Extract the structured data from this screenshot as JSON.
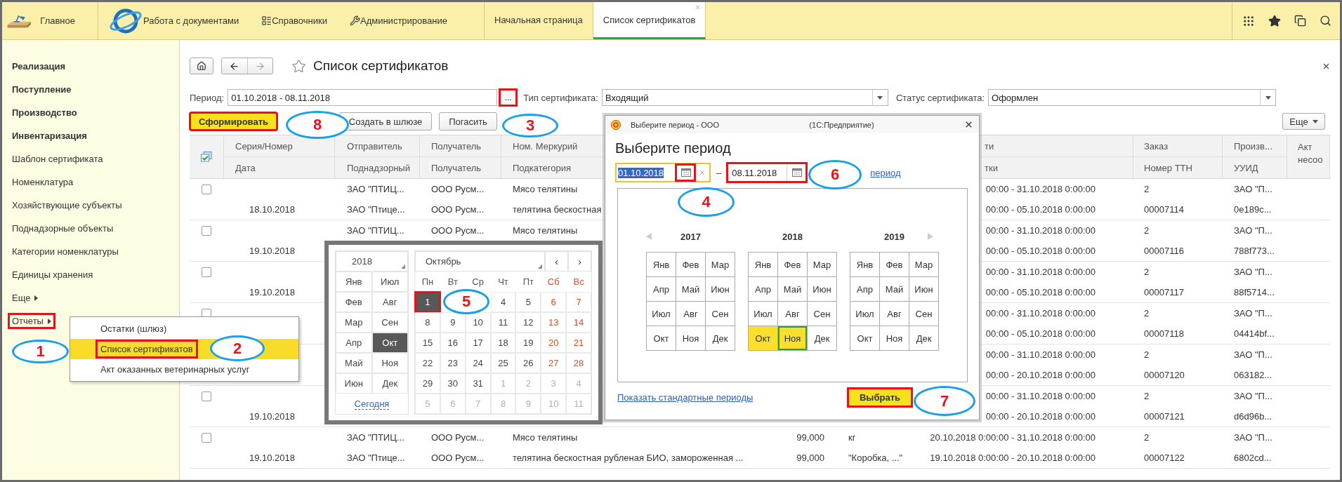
{
  "top_bar": {
    "sections": [
      {
        "label": "Главное",
        "kind": "home"
      },
      {
        "label": "Работа с документами",
        "kind": "globe"
      },
      {
        "label": "Справочники",
        "kind": "list"
      },
      {
        "label": "Администрирование",
        "kind": "wrench"
      }
    ],
    "tabs": [
      {
        "label": "Начальная страница",
        "selected": false
      },
      {
        "label": "Список сертификатов",
        "selected": true
      }
    ]
  },
  "sidebar": {
    "items": [
      {
        "label": "Реализация",
        "kind": "section",
        "marked": false
      },
      {
        "label": "Поступление",
        "kind": "section",
        "marked": false
      },
      {
        "label": "Производство",
        "kind": "section",
        "marked": false
      },
      {
        "label": "Инвентаризация",
        "kind": "section",
        "marked": false
      },
      {
        "label": "Шаблон сертификата",
        "kind": "item",
        "marked": false
      },
      {
        "label": "Номенклатура",
        "kind": "item",
        "marked": false
      },
      {
        "label": "Хозяйствующие субъекты",
        "kind": "item",
        "marked": false
      },
      {
        "label": "Поднадзорные объекты",
        "kind": "item",
        "marked": false
      },
      {
        "label": "Категории номенклатуры",
        "kind": "item",
        "marked": false
      },
      {
        "label": "Единицы хранения",
        "kind": "item",
        "marked": false
      },
      {
        "label": "Еще",
        "kind": "more",
        "marked": false
      },
      {
        "label": "Отчеты",
        "kind": "more",
        "marked": true
      }
    ]
  },
  "reports_menu": {
    "items": [
      {
        "label": "Остатки (шлюз)",
        "selected": false,
        "marked": false
      },
      {
        "label": "Список сертификатов",
        "selected": true,
        "marked": true
      },
      {
        "label": "Акт оказанных ветеринарных услуг",
        "selected": false,
        "marked": false
      }
    ]
  },
  "form": {
    "title": "Список сертификатов",
    "period": {
      "label": "Период:",
      "value": "01.10.2018 - 08.11.2018",
      "button": "...",
      "marked": true
    },
    "certificate_type": {
      "label": "Тип сертификата:",
      "value": "Входящий"
    },
    "certificate_status": {
      "label": "Статус сертификата:",
      "value": "Оформлен"
    },
    "buttons": [
      {
        "label": "Сформировать",
        "kind": "primary",
        "marked": true
      },
      {
        "label": "Создать в шлюзе",
        "kind": "normal",
        "marked": false
      },
      {
        "label": "Погасить",
        "kind": "normal",
        "marked": false
      }
    ],
    "more_button": "Еще"
  },
  "table": {
    "columns": {
      "series": {
        "top": "Серия/Номер",
        "bottom": "Дата"
      },
      "sender": {
        "top": "Отправитель",
        "bottom": "Поднадзорный"
      },
      "recipient": {
        "top": "Получатель",
        "bottom": "Получатель"
      },
      "mercury": {
        "top": "Ном. Меркурий",
        "bottom": "Подкатегория"
      },
      "column_7": {
        "top": "ти",
        "bottom": "тки"
      },
      "order": {
        "top": "Заказ",
        "bottom": "Номер ТТН"
      },
      "producer": {
        "top": "Произв...",
        "bottom": "УУИД"
      },
      "act": {
        "top": "Акт несоо"
      }
    },
    "rows": [
      {
        "checked": false,
        "line_1": {
          "sender": "ЗАО \"ПТИЦ...",
          "recipient": "ООО Русм...",
          "mercury": "Мясо телятины",
          "column_7": "00:00 - 31.10.2018 0:00:00",
          "order": "2",
          "producer": "ЗАО \"П..."
        },
        "line_2": {
          "series": "18.10.2018",
          "sender": "ЗАО \"Птице...",
          "recipient": "ООО Русм...",
          "mercury": "телятина бескостная",
          "column_7": "00:00 - 05.10.2018 0:00:00",
          "order": "00007114",
          "producer": "0e189c..."
        }
      },
      {
        "checked": false,
        "line_1": {
          "sender": "ЗАО \"ПТИЦ...",
          "recipient": "ООО Русм...",
          "mercury": "Мясо телятины",
          "column_7": "00:00 - 31.10.2018 0:00:00",
          "order": "2",
          "producer": "ЗАО \"П..."
        },
        "line_2": {
          "series": "19.10.2018",
          "column_7": "00:00 - 05.10.2018 0:00:00",
          "order": "00007116",
          "producer": "788f773..."
        }
      },
      {
        "checked": false,
        "line_1": {
          "column_7": "00:00 - 31.10.2018 0:00:00",
          "order": "2",
          "producer": "ЗАО \"П..."
        },
        "line_2": {
          "series": "19.10.2018",
          "column_7": "00:00 - 05.10.2018 0:00:00",
          "order": "00007117",
          "producer": "88f5714..."
        }
      },
      {
        "checked": false,
        "line_1": {
          "column_7": "00:00 - 31.10.2018 0:00:00",
          "order": "2",
          "producer": "ЗАО \"П..."
        },
        "line_2": {
          "column_7": "00:00 - 05.10.2018 0:00:00",
          "order": "00007118",
          "producer": "04414bf..."
        }
      },
      {
        "line_1": {
          "column_7": "00:00 - 31.10.2018 0:00:00",
          "order": "2",
          "producer": "ЗАО \"П..."
        },
        "line_2": {
          "column_7": "00:00 - 20.10.2018 0:00:00",
          "order": "00007120",
          "producer": "063182..."
        }
      },
      {
        "checked": false,
        "line_1": {
          "column_7": "00:00 - 31.10.2018 0:00:00",
          "order": "2",
          "producer": "ЗАО \"П..."
        },
        "line_2": {
          "series": "19.10.2018",
          "column_7": "00:00 - 20.10.2018 0:00:00",
          "order": "00007121",
          "producer": "d6d96b..."
        }
      },
      {
        "checked": false,
        "line_1": {
          "sender": "ЗАО \"ПТИЦ...",
          "recipient": "ООО Русм...",
          "mercury": "Мясо телятины",
          "column_5": "99,000",
          "column_6": "кг",
          "column_7": "20.10.2018 0:00:00 - 31.10.2018 0:00:00",
          "order": "2",
          "producer": "ЗАО \"П..."
        },
        "line_2": {
          "series": "19.10.2018",
          "sender": "ЗАО \"Птице...",
          "recipient": "ООО Русм...",
          "mercury": "телятина бескостная рубленая БИО, замороженная ...",
          "column_5": "99,000",
          "column_6": "\"Коробка, ...\"",
          "column_7": "19.10.2018 0:00:00 - 20.10.2018 0:00:00",
          "order": "00007122",
          "producer": "6802cd..."
        }
      }
    ]
  },
  "date_picker": {
    "year": "2018",
    "months": [
      {
        "label": "Янв",
        "selected": false
      },
      {
        "label": "Июл",
        "selected": false
      },
      {
        "label": "Фев",
        "selected": false
      },
      {
        "label": "Авг",
        "selected": false
      },
      {
        "label": "Мар",
        "selected": false
      },
      {
        "label": "Сен",
        "selected": false
      },
      {
        "label": "Апр",
        "selected": false
      },
      {
        "label": "Окт",
        "selected": true
      },
      {
        "label": "Май",
        "selected": false
      },
      {
        "label": "Ноя",
        "selected": false
      },
      {
        "label": "Июн",
        "selected": false
      },
      {
        "label": "Дек",
        "selected": false
      }
    ],
    "today": "Сегодня",
    "month": "Октябрь",
    "prev": "‹",
    "next": "›",
    "weekdays": [
      "Пн",
      "Вт",
      "Ср",
      "Чт",
      "Пт",
      "Сб",
      "Вс"
    ],
    "days": [
      {
        "day": "1",
        "kind": "current",
        "selected": true,
        "marked": true
      },
      {
        "kind": "hidden"
      },
      {
        "kind": "hidden"
      },
      {
        "day": "4",
        "kind": "current",
        "selected": false,
        "marked": false
      },
      {
        "day": "5",
        "kind": "current",
        "selected": false,
        "marked": false
      },
      {
        "day": "6",
        "kind": "current",
        "selected": false,
        "marked": false
      },
      {
        "day": "7",
        "kind": "current",
        "selected": false,
        "marked": false
      },
      {
        "day": "8",
        "kind": "current",
        "selected": false,
        "marked": false
      },
      {
        "day": "9",
        "kind": "current",
        "selected": false,
        "marked": false
      },
      {
        "day": "10",
        "kind": "current",
        "selected": false,
        "marked": false
      },
      {
        "day": "11",
        "kind": "current",
        "selected": false,
        "marked": false
      },
      {
        "day": "12",
        "kind": "current",
        "selected": false,
        "marked": false
      },
      {
        "day": "13",
        "kind": "current",
        "selected": false,
        "marked": false
      },
      {
        "day": "14",
        "kind": "current",
        "selected": false,
        "marked": false
      },
      {
        "day": "15",
        "kind": "current",
        "selected": false,
        "marked": false
      },
      {
        "day": "16",
        "kind": "current",
        "selected": false,
        "marked": false
      },
      {
        "day": "17",
        "kind": "current",
        "selected": false,
        "marked": false
      },
      {
        "day": "18",
        "kind": "current",
        "selected": false,
        "marked": false
      },
      {
        "day": "19",
        "kind": "current",
        "selected": false,
        "marked": false
      },
      {
        "day": "20",
        "kind": "current",
        "selected": false,
        "marked": false
      },
      {
        "day": "21",
        "kind": "current",
        "selected": false,
        "marked": false
      },
      {
        "day": "22",
        "kind": "current",
        "selected": false,
        "marked": false
      },
      {
        "day": "23",
        "kind": "current",
        "selected": false,
        "marked": false
      },
      {
        "day": "24",
        "kind": "current",
        "selected": false,
        "marked": false
      },
      {
        "day": "25",
        "kind": "current",
        "selected": false,
        "marked": false
      },
      {
        "day": "26",
        "kind": "current",
        "selected": false,
        "marked": false
      },
      {
        "day": "27",
        "kind": "current",
        "selected": false,
        "marked": false
      },
      {
        "day": "28",
        "kind": "current",
        "selected": false,
        "marked": false
      },
      {
        "day": "29",
        "kind": "current",
        "selected": false,
        "marked": false
      },
      {
        "day": "30",
        "kind": "current",
        "selected": false,
        "marked": false
      },
      {
        "day": "31",
        "kind": "current",
        "selected": false,
        "marked": false
      },
      {
        "day": "1",
        "kind": "other",
        "selected": false,
        "marked": false
      },
      {
        "day": "2",
        "kind": "other",
        "selected": false,
        "marked": false
      },
      {
        "day": "3",
        "kind": "other",
        "selected": false,
        "marked": false
      },
      {
        "day": "4",
        "kind": "other",
        "selected": false,
        "marked": false
      },
      {
        "day": "5",
        "kind": "other",
        "selected": false,
        "marked": false
      },
      {
        "day": "6",
        "kind": "other",
        "selected": false,
        "marked": false
      },
      {
        "day": "7",
        "kind": "other",
        "selected": false,
        "marked": false
      },
      {
        "day": "8",
        "kind": "other",
        "selected": false,
        "marked": false
      },
      {
        "day": "9",
        "kind": "other",
        "selected": false,
        "marked": false
      },
      {
        "day": "10",
        "kind": "other",
        "selected": false,
        "marked": false
      },
      {
        "day": "11",
        "kind": "other",
        "selected": false,
        "marked": false
      }
    ]
  },
  "period_dialog": {
    "title": "Выберите период - ООО",
    "app": "(1С:Предприятие)",
    "heading": "Выберите период",
    "start_date": "01.10.2018",
    "start_text_selected": true,
    "start_icon_marked": true,
    "dash": "–",
    "end_date": "08.11.2018",
    "end_marked": true,
    "link": "период",
    "years": [
      {
        "year": "2017",
        "months": [
          {
            "label": "Янв",
            "selected": false,
            "focused": false
          },
          {
            "label": "Фев",
            "selected": false,
            "focused": false
          },
          {
            "label": "Мар",
            "selected": false,
            "focused": false
          },
          {
            "label": "Апр",
            "selected": false,
            "focused": false
          },
          {
            "label": "Май",
            "selected": false,
            "focused": false
          },
          {
            "label": "Июн",
            "selected": false,
            "focused": false
          },
          {
            "label": "Июл",
            "selected": false,
            "focused": false
          },
          {
            "label": "Авг",
            "selected": false,
            "focused": false
          },
          {
            "label": "Сен",
            "selected": false,
            "focused": false
          },
          {
            "label": "Окт",
            "selected": false,
            "focused": false
          },
          {
            "label": "Ноя",
            "selected": false,
            "focused": false
          },
          {
            "label": "Дек",
            "selected": false,
            "focused": false
          }
        ]
      },
      {
        "year": "2018",
        "months": [
          {
            "label": "Янв",
            "selected": false,
            "focused": false
          },
          {
            "label": "Фев",
            "selected": false,
            "focused": false
          },
          {
            "label": "Мар",
            "selected": false,
            "focused": false
          },
          {
            "label": "Апр",
            "selected": false,
            "focused": false
          },
          {
            "label": "Май",
            "selected": false,
            "focused": false
          },
          {
            "label": "Июн",
            "selected": false,
            "focused": false
          },
          {
            "label": "Июл",
            "selected": false,
            "focused": false
          },
          {
            "label": "Авг",
            "selected": false,
            "focused": false
          },
          {
            "label": "Сен",
            "selected": false,
            "focused": false
          },
          {
            "label": "Окт",
            "selected": true,
            "focused": false
          },
          {
            "label": "Ноя",
            "selected": true,
            "focused": true
          },
          {
            "label": "Дек",
            "selected": false,
            "focused": false
          }
        ]
      },
      {
        "year": "2019",
        "months": [
          {
            "label": "Янв",
            "selected": false,
            "focused": false
          },
          {
            "label": "Фев",
            "selected": false,
            "focused": false
          },
          {
            "label": "Мар",
            "selected": false,
            "focused": false
          },
          {
            "label": "Апр",
            "selected": false,
            "focused": false
          },
          {
            "label": "Май",
            "selected": false,
            "focused": false
          },
          {
            "label": "Июн",
            "selected": false,
            "focused": false
          },
          {
            "label": "Июл",
            "selected": false,
            "focused": false
          },
          {
            "label": "Авг",
            "selected": false,
            "focused": false
          },
          {
            "label": "Сен",
            "selected": false,
            "focused": false
          },
          {
            "label": "Окт",
            "selected": false,
            "focused": false
          },
          {
            "label": "Ноя",
            "selected": false,
            "focused": false
          },
          {
            "label": "Дек",
            "selected": false,
            "focused": false
          }
        ]
      }
    ],
    "standard_link": "Показать стандартные периоды",
    "select_button": {
      "label": "Выбрать",
      "marked": true
    }
  },
  "annotations": [
    {
      "number": "1"
    },
    {
      "number": "2"
    },
    {
      "number": "3"
    },
    {
      "number": "4"
    },
    {
      "number": "5"
    },
    {
      "number": "6"
    },
    {
      "number": "7"
    },
    {
      "number": "8"
    }
  ]
}
